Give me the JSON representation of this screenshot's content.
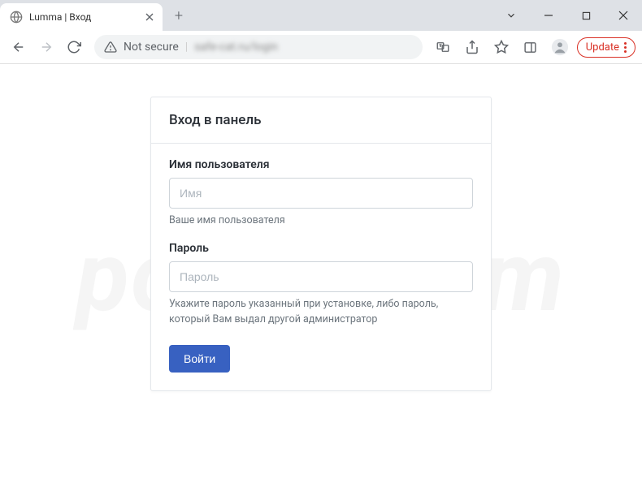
{
  "tab": {
    "title": "Lumma | Вход"
  },
  "address": {
    "not_secure": "Not secure",
    "url": "safe-cat.ru/login"
  },
  "update_label": "Update",
  "login": {
    "header": "Вход в панель",
    "username_label": "Имя пользователя",
    "username_placeholder": "Имя",
    "username_help": "Ваше имя пользователя",
    "password_label": "Пароль",
    "password_placeholder": "Пароль",
    "password_help": "Укажите пароль указанный при установке, либо пароль, который Вам выдал другой администратор",
    "submit": "Войти"
  },
  "watermark": "pcrisk.com"
}
